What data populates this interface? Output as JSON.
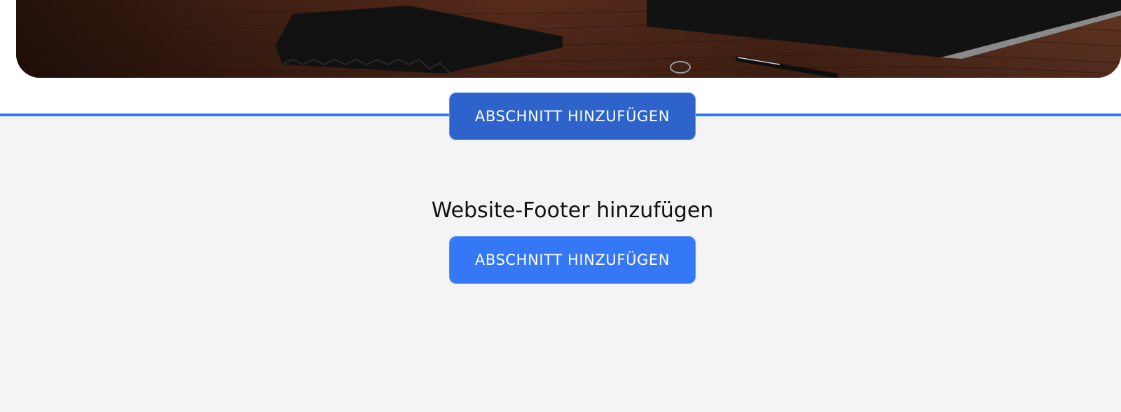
{
  "section_insert": {
    "add_section_label": "ABSCHNITT HINZUFÜGEN"
  },
  "footer": {
    "title": "Website-Footer hinzufügen",
    "add_section_label": "ABSCHNITT HINZUFÜGEN"
  },
  "colors": {
    "accent": "#3478f6",
    "accent_dark": "#2d63cb",
    "footer_background": "#f4f4f4"
  }
}
